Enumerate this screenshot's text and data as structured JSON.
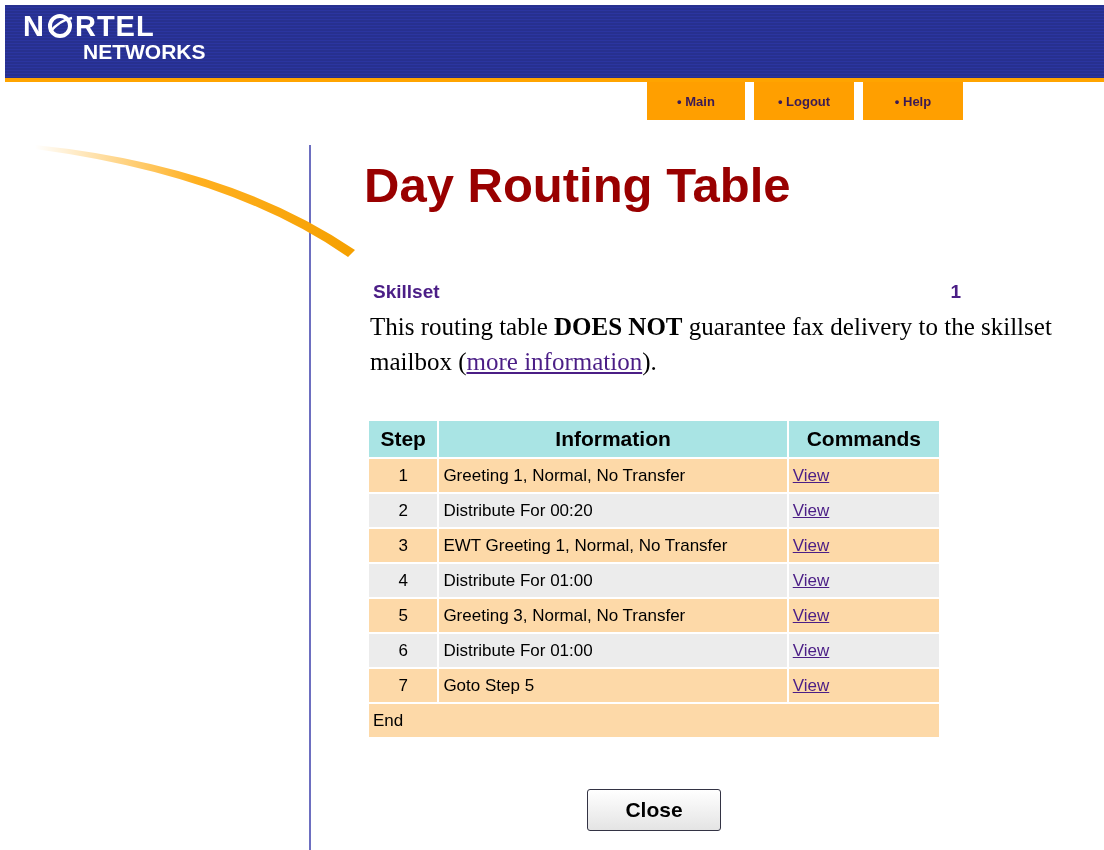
{
  "logo": {
    "prefix": "N",
    "suffix": "RTEL",
    "subtitle": "NETWORKS"
  },
  "nav": [
    {
      "bullet": "•",
      "label": "Main"
    },
    {
      "bullet": "•",
      "label": "Logout"
    },
    {
      "bullet": "•",
      "label": "Help"
    }
  ],
  "title": "Day Routing Table",
  "skillset": {
    "label": "Skillset",
    "value": "1"
  },
  "notice": {
    "text": "This routing table **DOES NOT** guarantee fax delivery to the skillset mailbox (",
    "link": "more information",
    "after": ")."
  },
  "table": {
    "columns": [
      "Step",
      "Information",
      "Commands"
    ],
    "rows": [
      {
        "step": "1",
        "information": "Greeting 1, Normal, No Transfer",
        "command": "View"
      },
      {
        "step": "2",
        "information": "Distribute For 00:20",
        "command": "View"
      },
      {
        "step": "3",
        "information": "EWT Greeting 1, Normal, No Transfer",
        "command": "View"
      },
      {
        "step": "4",
        "information": "Distribute For 01:00",
        "command": "View"
      },
      {
        "step": "5",
        "information": "Greeting 3, Normal, No Transfer",
        "command": "View"
      },
      {
        "step": "6",
        "information": "Distribute For 01:00",
        "command": "View"
      },
      {
        "step": "7",
        "information": "Goto Step 5",
        "command": "View"
      }
    ],
    "footer": "End"
  },
  "buttons": [
    "Close"
  ]
}
